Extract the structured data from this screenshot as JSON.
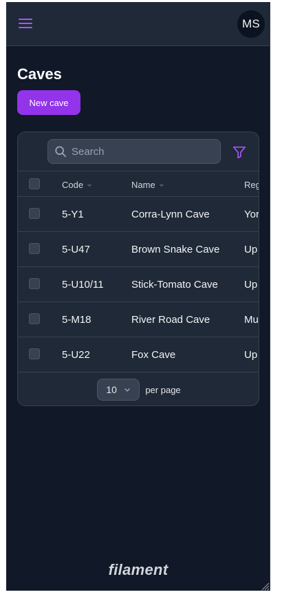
{
  "header": {
    "menu_icon": "hamburger-icon",
    "avatar_initials": "MS"
  },
  "page": {
    "title": "Caves",
    "new_button": "New cave"
  },
  "table": {
    "search_placeholder": "Search",
    "filter_icon": "funnel-icon",
    "columns": [
      "Code",
      "Name",
      "Reg"
    ],
    "rows": [
      {
        "code": "5-Y1",
        "name": "Corra-Lynn Cave",
        "region": "Yor"
      },
      {
        "code": "5-U47",
        "name": "Brown Snake Cave",
        "region": "Up"
      },
      {
        "code": "5-U10/11",
        "name": "Stick-Tomato Cave",
        "region": "Up"
      },
      {
        "code": "5-M18",
        "name": "River Road Cave",
        "region": "Mu"
      },
      {
        "code": "5-U22",
        "name": "Fox Cave",
        "region": "Up"
      }
    ],
    "per_page_value": "10",
    "per_page_label": "per page"
  },
  "footer": {
    "brand": "filament"
  },
  "colors": {
    "accent": "#9333ea",
    "accent_icon": "#a855f7",
    "background": "#111827",
    "surface": "#1f2937"
  }
}
